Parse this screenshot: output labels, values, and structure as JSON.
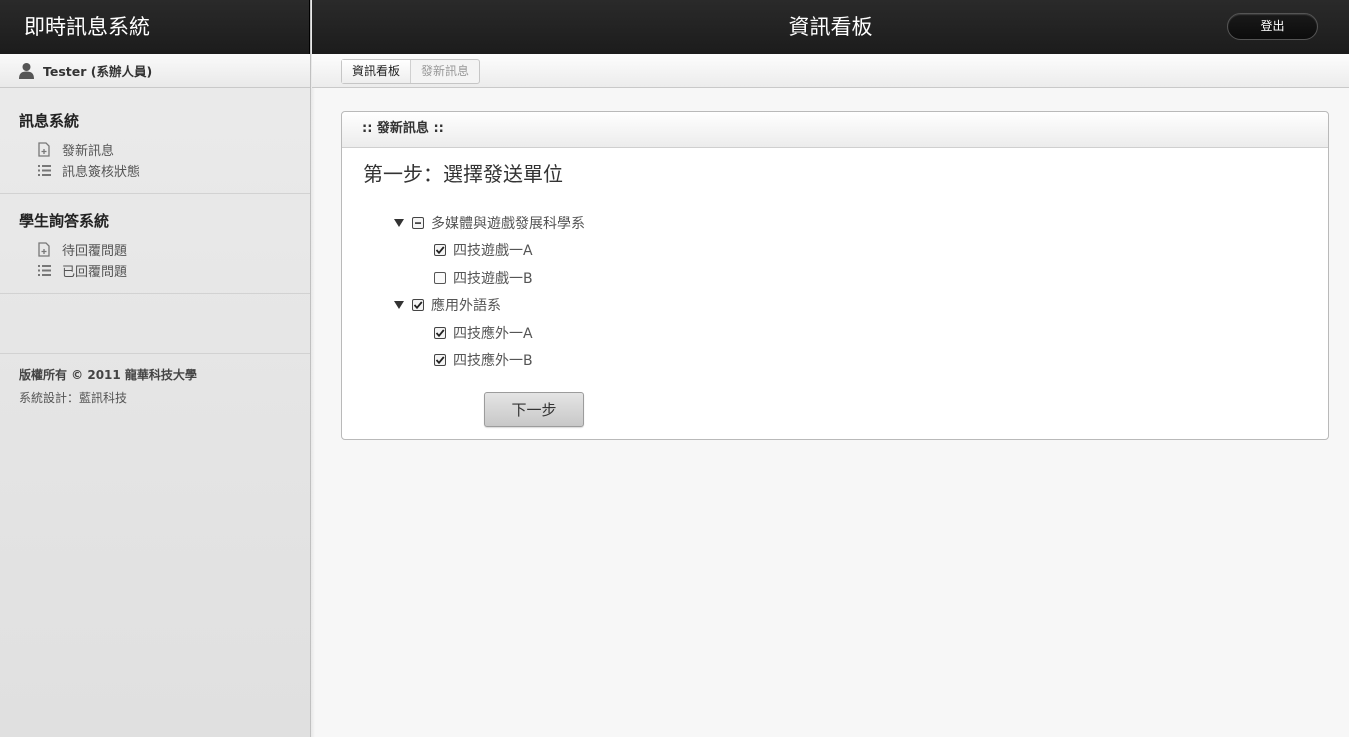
{
  "app": {
    "title": "即時訊息系統"
  },
  "header": {
    "title": "資訊看板",
    "logout_label": "登出"
  },
  "user": {
    "label": "Tester (系辦人員)"
  },
  "sidebar": {
    "sections": [
      {
        "title": "訊息系統",
        "items": [
          {
            "label": "發新訊息",
            "icon": "new-doc-icon"
          },
          {
            "label": "訊息簽核狀態",
            "icon": "list-icon"
          }
        ]
      },
      {
        "title": "學生詢答系統",
        "items": [
          {
            "label": "待回覆問題",
            "icon": "new-doc-icon"
          },
          {
            "label": "已回覆問題",
            "icon": "list-icon"
          }
        ]
      }
    ],
    "footer": {
      "copyright": "版權所有 © 2011 龍華科技大學",
      "design": "系統設計：藍訊科技"
    }
  },
  "breadcrumb": {
    "items": [
      "資訊看板",
      "發新訊息"
    ]
  },
  "panel": {
    "title": ":: 發新訊息 ::",
    "step_title": "第一步：選擇發送單位",
    "tree": [
      {
        "label": "多媒體與遊戲發展科學系",
        "state": "indeterminate",
        "children": [
          {
            "label": "四技遊戲一A",
            "checked": true
          },
          {
            "label": "四技遊戲一B",
            "checked": false
          }
        ]
      },
      {
        "label": "應用外語系",
        "state": "checked",
        "children": [
          {
            "label": "四技應外一A",
            "checked": true
          },
          {
            "label": "四技應外一B",
            "checked": true
          }
        ]
      }
    ],
    "next_label": "下一步"
  }
}
